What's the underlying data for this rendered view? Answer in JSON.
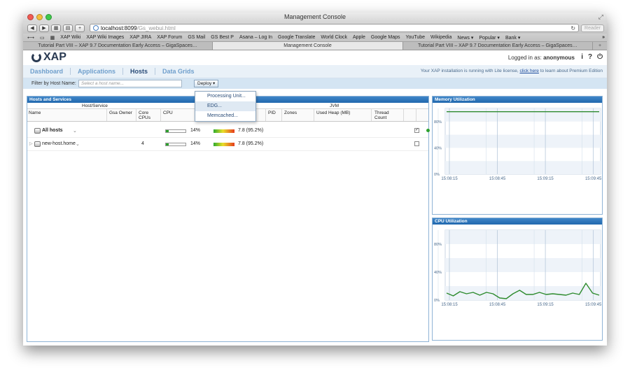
{
  "window": {
    "title": "Management Console"
  },
  "browser": {
    "url_host": "localhost:8099",
    "url_path": "/Gs_webui.html",
    "reader_label": "Reader",
    "bookmarks": [
      "XAP Wiki",
      "XAP Wiki Images",
      "XAP JIRA",
      "XAP Forum",
      "GS Mail",
      "GS Best P",
      "Asana – Log In",
      "Google Translate",
      "World Clock",
      "Apple",
      "Google Maps",
      "YouTube",
      "Wikipedia",
      "News ▾",
      "Popular ▾",
      "Bank ▾"
    ],
    "tabs": [
      {
        "label": "Tutorial Part VIII – XAP 9.7 Documentation Early Access – GigaSpaces…",
        "active": false
      },
      {
        "label": "Management Console",
        "active": true
      },
      {
        "label": "Tutorial Part VIII – XAP 9.7 Documentation Early Access – GigaSpaces…",
        "active": false
      }
    ]
  },
  "app": {
    "logo_text": "XAP",
    "login_prefix": "Logged in as:",
    "login_user": "anonymous",
    "nav": [
      "Dashboard",
      "Applications",
      "Hosts",
      "Data Grids"
    ],
    "nav_selected": "Hosts",
    "license_text": "Your XAP installation is running with Lite license,",
    "license_link": "click here",
    "license_suffix": "to learn about Premium Edition",
    "filter_label": "Filter by Host Name:",
    "filter_placeholder": "Select a host name...",
    "deploy_label": "Deploy ▾",
    "deploy_menu": [
      "Processing Unit...",
      "EDG...",
      "Memcached..."
    ]
  },
  "hosts_panel": {
    "title": "Hosts and Services",
    "group_host_service": "Host/Service",
    "group_jvm": "JVM",
    "columns": [
      "Name",
      "Gsa Owner",
      "Core CPUs",
      "CPU",
      "PID",
      "Zones",
      "Used Heap (MB)",
      "Thread Count"
    ],
    "rows": [
      {
        "name": "All hosts",
        "cores": "",
        "cpu_pct": "14%",
        "cpu_value": 0.14,
        "mem": "7.8 (95.2%)",
        "checked": true
      },
      {
        "name": "new-host.home",
        "cores": "4",
        "cpu_pct": "14%",
        "cpu_value": 0.14,
        "mem": "7.8 (95.2%)",
        "checked": false
      }
    ]
  },
  "memory_panel": {
    "title": "Memory Utilization",
    "y_ticks": [
      "80%",
      "40%",
      "0%"
    ],
    "x_ticks": [
      "15:08:15",
      "15:08:45",
      "15:09:15",
      "15:09:45"
    ]
  },
  "cpu_panel": {
    "title": "CPU Utilization",
    "y_ticks": [
      "80%",
      "40%",
      "0%"
    ],
    "x_ticks": [
      "15:08:15",
      "15:08:45",
      "15:09:15",
      "15:09:45"
    ]
  },
  "chart_data": [
    {
      "type": "line",
      "title": "Memory Utilization",
      "ylim": [
        0,
        100
      ],
      "x": [
        "15:08:00",
        "15:08:10",
        "15:08:20",
        "15:08:30",
        "15:08:40",
        "15:08:50",
        "15:09:00",
        "15:09:10",
        "15:09:20",
        "15:09:30",
        "15:09:40",
        "15:09:50"
      ],
      "series": [
        {
          "values": [
            95,
            95,
            95,
            95,
            95,
            95,
            95,
            95,
            95,
            95,
            95,
            95
          ],
          "color": "#2e8b2e"
        }
      ]
    },
    {
      "type": "line",
      "title": "CPU Utilization",
      "ylim": [
        0,
        100
      ],
      "x": [
        "15:08:00",
        "15:08:05",
        "15:08:10",
        "15:08:15",
        "15:08:20",
        "15:08:25",
        "15:08:30",
        "15:08:35",
        "15:08:40",
        "15:08:45",
        "15:08:50",
        "15:08:55",
        "15:09:00",
        "15:09:05",
        "15:09:10",
        "15:09:15",
        "15:09:20",
        "15:09:25",
        "15:09:30",
        "15:09:35",
        "15:09:40",
        "15:09:45",
        "15:09:50",
        "15:09:55"
      ],
      "series": [
        {
          "values": [
            10,
            6,
            12,
            9,
            11,
            7,
            11,
            9,
            3,
            2,
            9,
            14,
            8,
            8,
            11,
            8,
            9,
            8,
            7,
            10,
            8,
            24,
            10,
            7
          ],
          "color": "#2e8b2e"
        }
      ]
    }
  ]
}
